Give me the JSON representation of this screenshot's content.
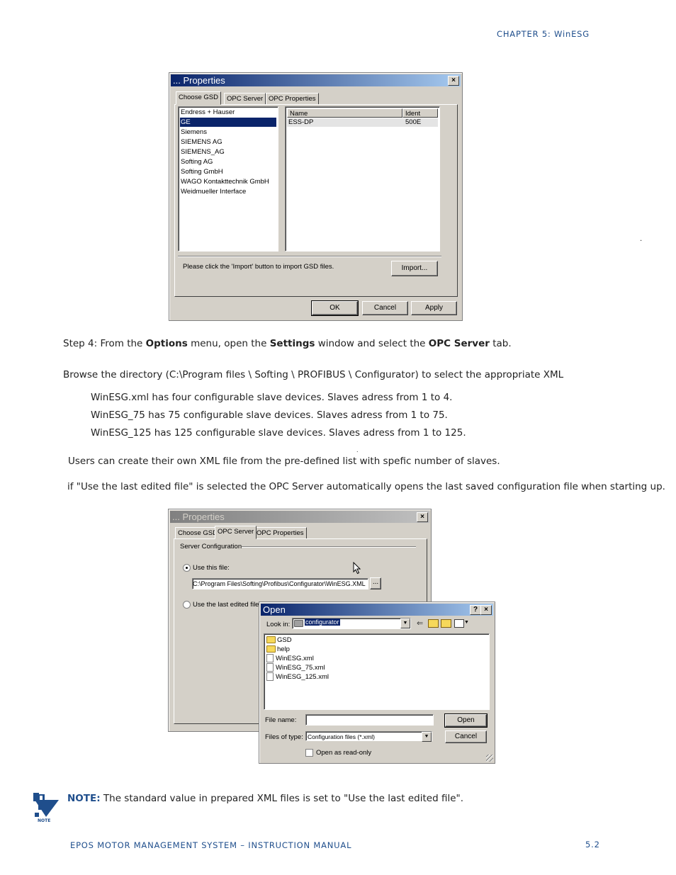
{
  "header": {
    "chapter": "CHAPTER 5: WinESG"
  },
  "dialog1": {
    "title": "... Properties",
    "close": "×",
    "tabs": [
      "Choose GSD",
      "OPC Server",
      "OPC Properties"
    ],
    "vendors": [
      "Endress + Hauser",
      "GE",
      "Siemens",
      "SIEMENS AG",
      "SIEMENS_AG",
      "Softing AG",
      "Softing GmbH",
      "WAGO Kontakttechnik GmbH",
      "Weidmueller Interface"
    ],
    "selected_vendor_index": 1,
    "columns": [
      "Name",
      "Ident"
    ],
    "row": {
      "name": "ESS-DP",
      "ident": "500E"
    },
    "hint": "Please click the 'Import' button to import GSD files.",
    "import_button": "Import...",
    "ok": "OK",
    "cancel": "Cancel",
    "apply": "Apply"
  },
  "stray_dot": ".",
  "text": {
    "step4_a": "Step 4: From the ",
    "step4_b": "Options",
    "step4_c": " menu, open the ",
    "step4_d": "Settings",
    "step4_e": " window and select the ",
    "step4_f": "OPC Server",
    "step4_g": " tab.",
    "browse": "Browse the directory (C:\\Program files \\ Softing \\ PROFIBUS \\ Configurator) to select the appropriate XML",
    "item1": "WinESG.xml has four configurable slave devices. Slaves adress from 1 to 4.",
    "item2": "WinESG_75 has 75 configurable slave devices. Slaves adress from 1 to 75.",
    "item3": "WinESG_125 has 125 configurable slave devices. Slaves adress from 1 to 125.",
    "small_dot": ".",
    "users": "Users can create their own XML file from the pre-defined list  with spefic number of slaves.",
    "if_text": "if  \"Use the last edited file\" is selected  the OPC Server automatically opens the last saved configuration file when  starting up."
  },
  "dialog2": {
    "title": "... Properties",
    "close": "×",
    "tabs": [
      "Choose GSD",
      "OPC Server",
      "OPC Properties"
    ],
    "group": "Server Configuration",
    "use_this_file": "Use this file:",
    "file_path": "C:\\Program Files\\Softing\\Profibus\\Configurator\\WinESG.XML",
    "browse_btn": "...",
    "use_last": "Use the last edited file"
  },
  "open_dialog": {
    "title": "Open",
    "help": "?",
    "close": "×",
    "look_in_label": "Look in:",
    "look_in_value": "configurator",
    "folders": [
      "GSD",
      "help"
    ],
    "files": [
      "WinESG.xml",
      "WinESG_75.xml",
      "WinESG_125.xml"
    ],
    "file_name_label": "File name:",
    "file_name_value": "",
    "file_type_label": "Files of type:",
    "file_type_value": "Configuration files (*.xml)",
    "open_btn": "Open",
    "cancel_btn": "Cancel",
    "read_only": "Open as read-only"
  },
  "note": {
    "icon_label": "NOTE",
    "label": "NOTE:",
    "text": " The standard value in prepared XML files is set to \"Use the last edited file\"."
  },
  "footer": {
    "manual": "EPOS MOTOR MANAGEMENT SYSTEM – INSTRUCTION MANUAL",
    "page": "5.2"
  },
  "colors": {
    "accent": "#1f4e8c",
    "title_active": "#0a246a",
    "dialog_face": "#d4d0c8"
  }
}
